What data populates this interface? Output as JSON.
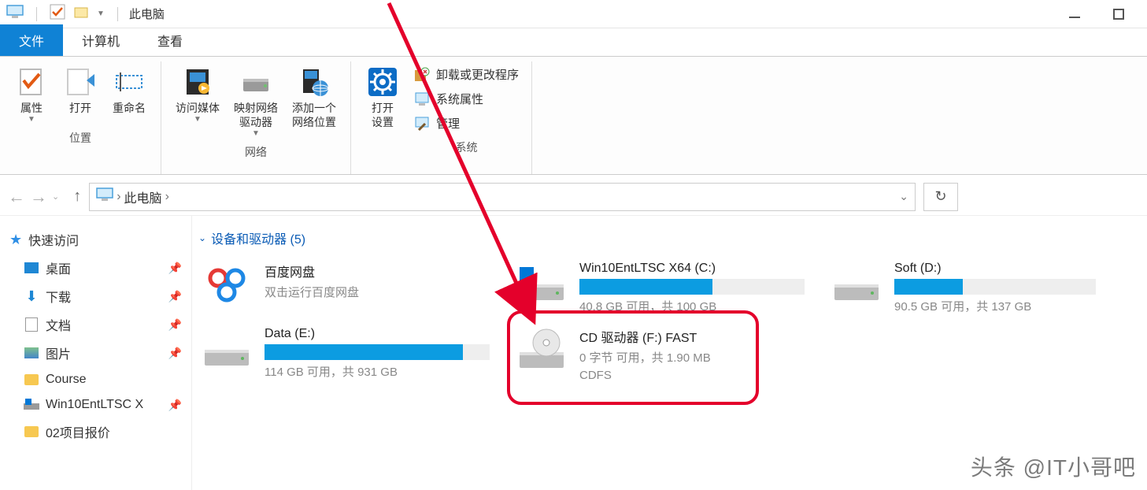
{
  "title_bar": {
    "title": "此电脑"
  },
  "tabs": {
    "file": "文件",
    "computer": "计算机",
    "view": "查看"
  },
  "ribbon": {
    "group_location": {
      "label": "位置",
      "properties": "属性",
      "open": "打开",
      "rename": "重命名"
    },
    "group_network": {
      "label": "网络",
      "media": "访问媒体",
      "map_drive": "映射网络\n驱动器",
      "add_location": "添加一个\n网络位置"
    },
    "group_system": {
      "label": "系统",
      "open_settings": "打开\n设置",
      "uninstall": "卸载或更改程序",
      "sys_props": "系统属性",
      "manage": "管理"
    }
  },
  "nav": {
    "location": "此电脑"
  },
  "sidebar": {
    "quick_access": "快速访问",
    "items": [
      {
        "icon": "desktop",
        "label": "桌面",
        "pinned": true
      },
      {
        "icon": "download",
        "label": "下载",
        "pinned": true
      },
      {
        "icon": "document",
        "label": "文档",
        "pinned": true
      },
      {
        "icon": "picture",
        "label": "图片",
        "pinned": true
      },
      {
        "icon": "folder",
        "label": "Course",
        "pinned": false
      },
      {
        "icon": "disk",
        "label": "Win10EntLTSC X",
        "pinned": true
      },
      {
        "icon": "folder",
        "label": "02项目报价",
        "pinned": false
      }
    ]
  },
  "content": {
    "section_title": "设备和驱动器 (5)",
    "drives": [
      {
        "type": "app",
        "name": "百度网盘",
        "sub": "双击运行百度网盘"
      },
      {
        "type": "disk",
        "name": "Win10EntLTSC X64 (C:)",
        "free": "40.8 GB 可用，共 100 GB",
        "fill": 59
      },
      {
        "type": "disk",
        "name": "Soft (D:)",
        "free": "90.5 GB 可用，共 137 GB",
        "fill": 34
      },
      {
        "type": "disk",
        "name": "Data (E:)",
        "free": "114 GB 可用，共 931 GB",
        "fill": 88
      },
      {
        "type": "cd",
        "name": "CD 驱动器 (F:) FAST",
        "sub": "0 字节 可用，共 1.90 MB",
        "sub2": "CDFS"
      }
    ]
  },
  "watermark": "头条 @IT小哥吧"
}
